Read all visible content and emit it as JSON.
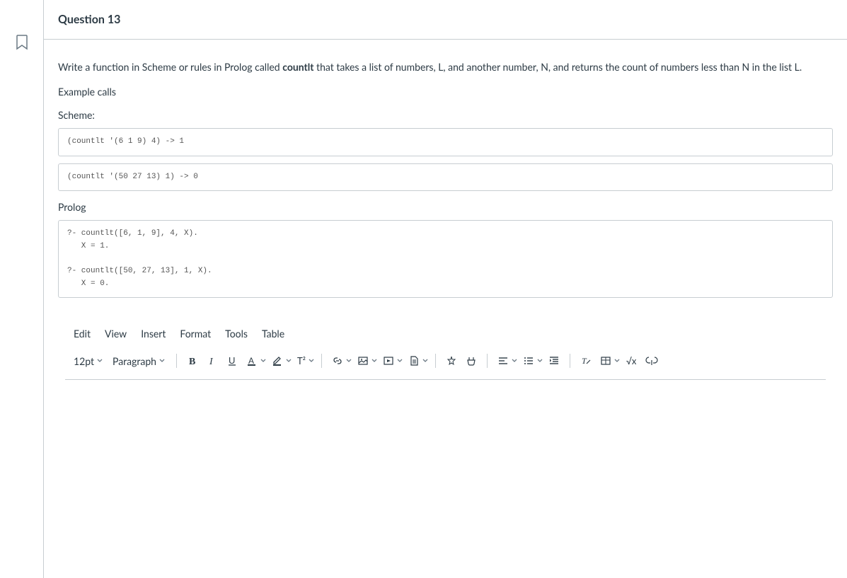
{
  "header": {
    "title": "Question 13"
  },
  "prompt": {
    "intro_before_strong": "Write a function in Scheme or rules in Prolog called ",
    "strong_word": "countlt",
    "intro_after_strong": " that takes a list of numbers, L, and another number, N, and returns the count of numbers less than N in the list L.",
    "example_label": "Example calls",
    "scheme_label": "Scheme:",
    "scheme_code_1": "(countlt '(6 1 9) 4) -> 1",
    "scheme_code_2": "(countlt '(50 27 13) 1) -> 0",
    "prolog_label": "Prolog",
    "prolog_code": "?- countlt([6, 1, 9], 4, X).\n   X = 1.\n\n?- countlt([50, 27, 13], 1, X).\n   X = 0."
  },
  "editor": {
    "menubar": [
      "Edit",
      "View",
      "Insert",
      "Format",
      "Tools",
      "Table"
    ],
    "font_size": "12pt",
    "block_format": "Paragraph",
    "superscript_label": "T²",
    "equation_label": "√x"
  }
}
